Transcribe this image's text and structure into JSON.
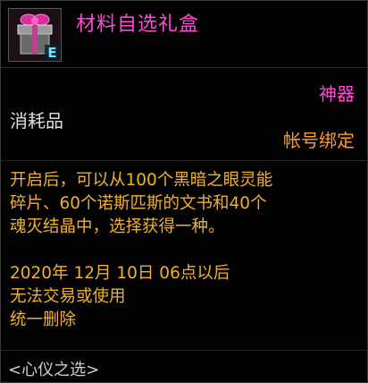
{
  "item": {
    "name": "材料自选礼盒",
    "icon": "gift-box-icon",
    "icon_badge": "E",
    "rarity": "神器",
    "category": "消耗品",
    "binding": "帐号绑定",
    "description_lines": [
      "开启后，可以从100个黑暗之眼灵能",
      "碎片、60个诺斯匹斯的文书和40个",
      "魂灭结晶中，选择获得一种。"
    ],
    "expiry_lines": [
      "2020年 12月 10日 06点以后",
      "无法交易或使用",
      "统一删除"
    ],
    "source": "<心仪之选>"
  },
  "colors": {
    "rarity": "#ff4ad6",
    "binding": "#ff9933",
    "description": "#f0b030",
    "category": "#e0e0e0"
  }
}
